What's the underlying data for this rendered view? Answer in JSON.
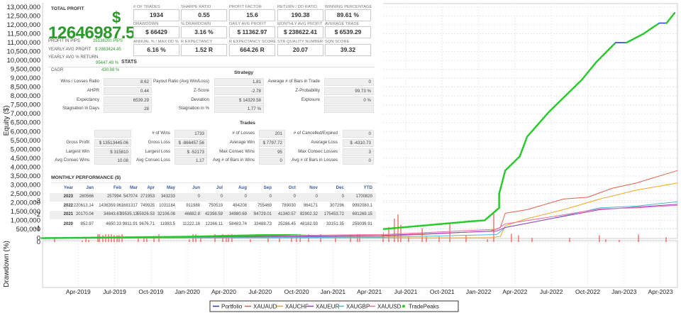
{
  "header": {
    "total_profit_label": "TOTAL PROFIT",
    "currency_symbol": "$",
    "total_profit_value": "12646987.5",
    "profit_in_pips_label": "PROFIT IN PIPS",
    "profit_in_pips_value": "25138200 PIPS",
    "yearly_avg_profit_label": "YEARLY AVG PROFIT",
    "yearly_avg_profit_value": "$ 2863424.45",
    "yearly_avg_return_label": "YEARLY AVG % RETURN",
    "yearly_avg_return_value": "95447.48 %",
    "stats_title": "STATS",
    "cagr_label": "CAGR",
    "cagr_value": "430.88 %"
  },
  "metrics": [
    {
      "label": "# OF TRADES",
      "value": "1934"
    },
    {
      "label": "SHARPE RATIO",
      "value": "0.55"
    },
    {
      "label": "PROFIT FACTOR",
      "value": "15.6"
    },
    {
      "label": "RETURN / DD RATIO",
      "value": "190.38"
    },
    {
      "label": "WINNING PERCENTAGE",
      "value": "89.61 %"
    },
    {
      "label": "DRAWDOWN",
      "value": "$ 66429"
    },
    {
      "label": "% DRAWDOWN",
      "value": "3.16 %"
    },
    {
      "label": "DAILY AVG PROFIT",
      "value": "$ 11362.97"
    },
    {
      "label": "MONTHLY AVG PROFIT",
      "value": "$ 238622.41"
    },
    {
      "label": "AVERAGE TRADE",
      "value": "$ 6539.29"
    },
    {
      "label": "ANNUAL % / MAX DD %",
      "value": "6.16 %"
    },
    {
      "label": "R EXPECTANCY",
      "value": "1.52 R"
    },
    {
      "label": "R EXPECTANCY SCORE",
      "value": "664.26 R"
    },
    {
      "label": "STR QUALITY NUMBER",
      "value": "20.07"
    },
    {
      "label": "SQN SCORE",
      "value": "39.32"
    }
  ],
  "strategy": {
    "title": "Strategy",
    "rows": [
      [
        {
          "label": "Wins / Losses Ratio",
          "value": "8.62"
        },
        {
          "label": "Payout Ratio (Avg Win/Loss)",
          "value": "1.81"
        },
        {
          "label": "Average # of Bars in Trade",
          "value": "0"
        }
      ],
      [
        {
          "label": "AHPR",
          "value": "0.44"
        },
        {
          "label": "Z-Score",
          "value": "-2.78"
        },
        {
          "label": "Z-Probability",
          "value": "99.73 %"
        }
      ],
      [
        {
          "label": "Expectancy",
          "value": "6539.29"
        },
        {
          "label": "Deviation",
          "value": "$ 14329.58"
        },
        {
          "label": "Exposure",
          "value": "0 %"
        }
      ],
      [
        {
          "label": "Stagnation in Days",
          "value": "28"
        },
        {
          "label": "Stagnation in %",
          "value": "1.77 %"
        },
        {
          "label": "",
          "value": ""
        }
      ]
    ]
  },
  "trades": {
    "title": "Trades",
    "rows": [
      [
        {
          "label": "",
          "value": ""
        },
        {
          "label": "# of Wins",
          "value": "1733"
        },
        {
          "label": "# of Losses",
          "value": "201"
        },
        {
          "label": "# of Cancelled/Expired",
          "value": "0"
        }
      ],
      [
        {
          "label": "Gross Profit",
          "value": "$ 13513445.06"
        },
        {
          "label": "Gross Loss",
          "value": "$ -866457.56"
        },
        {
          "label": "Average Win",
          "value": "$ 7797.72"
        },
        {
          "label": "Average Loss",
          "value": "$ -4310.73"
        }
      ],
      [
        {
          "label": "Largest Win",
          "value": "$ 315810"
        },
        {
          "label": "Largest Loss",
          "value": "$ -52173"
        },
        {
          "label": "Max Consec Wins",
          "value": "95"
        },
        {
          "label": "Max Consec Losses",
          "value": "3"
        }
      ],
      [
        {
          "label": "Avg Consec Wins",
          "value": "10.08"
        },
        {
          "label": "Avg Consec Loss",
          "value": "1.17"
        },
        {
          "label": "Avg # of Bars in Wins",
          "value": "0"
        },
        {
          "label": "Avg # of Bars in Losses",
          "value": "0"
        }
      ]
    ]
  },
  "monthly": {
    "title": "MONTHLY PERFORMANCE ($)",
    "headers": [
      "Year",
      "Jan",
      "Feb",
      "Mar",
      "Apr",
      "May",
      "Jun",
      "Jul",
      "Aug",
      "Sep",
      "Oct",
      "Nov",
      "Dec",
      "YTD"
    ],
    "rows": [
      [
        "2023",
        "280566",
        "257994",
        "547074",
        "271953",
        "343233",
        "0",
        "0",
        "0",
        "0",
        "0",
        "0",
        "0",
        "1700820"
      ],
      [
        "2022",
        "220613.14",
        "1436359.96",
        "1681317",
        "749925",
        "1031184",
        "911988",
        "750519",
        "494208",
        "755469",
        "789030",
        "864171",
        "307296",
        "9992080.1"
      ],
      [
        "2021",
        "20170.04",
        "34843.67",
        "39535.13",
        "55926.53",
        "32106.08",
        "46882.8",
        "42398.59",
        "34980.69",
        "84729.01",
        "41340.57",
        "82902.32",
        "175453.72",
        "691269.15"
      ],
      [
        "2020",
        "852.97",
        "4650.33",
        "9811.91",
        "9676.71",
        "11983.5",
        "11222.18",
        "12266.11",
        "58463.74",
        "33488.73",
        "25286.45",
        "48182.93",
        "33151.35",
        "259036.91"
      ]
    ]
  },
  "chart_data": {
    "type": "line",
    "x_units": "months since Jan-2019",
    "xlim": [
      0,
      52.5
    ],
    "x_ticks": [
      {
        "x": 3,
        "label": "Apr-2019"
      },
      {
        "x": 6,
        "label": "Jul-2019"
      },
      {
        "x": 9,
        "label": "Oct-2019"
      },
      {
        "x": 12,
        "label": "Jan-2020"
      },
      {
        "x": 15,
        "label": "Apr-2020"
      },
      {
        "x": 18,
        "label": "Jul-2020"
      },
      {
        "x": 21,
        "label": "Oct-2020"
      },
      {
        "x": 24,
        "label": "Jan-2021"
      },
      {
        "x": 27,
        "label": "Apr-2021"
      },
      {
        "x": 30,
        "label": "Jul-2021"
      },
      {
        "x": 33,
        "label": "Oct-2021"
      },
      {
        "x": 36,
        "label": "Jan-2022"
      },
      {
        "x": 39,
        "label": "Apr-2022"
      },
      {
        "x": 42,
        "label": "Jul-2022"
      },
      {
        "x": 45,
        "label": "Oct-2022"
      },
      {
        "x": 48,
        "label": "Jan-2023"
      },
      {
        "x": 51,
        "label": "Apr-2023"
      }
    ],
    "equity": {
      "ylabel": "Equity ($)",
      "ylim": [
        0,
        13300000
      ],
      "y_ticks": [
        0,
        500000,
        1000000,
        1500000,
        2000000,
        2500000,
        3000000,
        3500000,
        4000000,
        4500000,
        5000000,
        5500000,
        6000000,
        6500000,
        7000000,
        7500000,
        8000000,
        8500000,
        9000000,
        9500000,
        10000000,
        10500000,
        11000000,
        11500000,
        12000000,
        12500000,
        13000000
      ],
      "y_tick_labels": [
        "0",
        "500,000",
        "1,000,000",
        "1,500,000",
        "2,000,000",
        "2,500,000",
        "3,000,000",
        "3,500,000",
        "4,000,000",
        "4,500,000",
        "5,000,000",
        "5,500,000",
        "6,000,000",
        "6,500,000",
        "7,000,000",
        "7,500,000",
        "8,000,000",
        "8,500,000",
        "9,000,000",
        "9,500,000",
        "10,000,000",
        "10,500,000",
        "11,000,000",
        "11,500,000",
        "12,000,000",
        "12,500,000",
        "13,000,000"
      ],
      "series": [
        {
          "name": "XAUAUD",
          "color": "#e0604a",
          "points": [
            [
              0,
              0
            ],
            [
              28,
              100000
            ],
            [
              37,
              400000
            ],
            [
              37.8,
              600000
            ],
            [
              38.2,
              1400000
            ],
            [
              40,
              1600000
            ],
            [
              43,
              2200000
            ],
            [
              45,
              2300000
            ],
            [
              47,
              2800000
            ],
            [
              49,
              3100000
            ],
            [
              52.4,
              3800000
            ]
          ]
        },
        {
          "name": "XAUCHF",
          "color": "#f5a623",
          "points": [
            [
              0,
              0
            ],
            [
              37,
              20000
            ],
            [
              37.8,
              100000
            ],
            [
              38.2,
              700000
            ],
            [
              40,
              1100000
            ],
            [
              43,
              1600000
            ],
            [
              46,
              2200000
            ],
            [
              49,
              2700000
            ],
            [
              52.4,
              3100000
            ]
          ]
        },
        {
          "name": "XAUGBP",
          "color": "#4fb8d8",
          "points": [
            [
              0,
              0
            ],
            [
              28,
              50000
            ],
            [
              37.5,
              200000
            ],
            [
              38.2,
              600000
            ],
            [
              42,
              1100000
            ],
            [
              46,
              1700000
            ],
            [
              49,
              1800000
            ],
            [
              52.4,
              2050000
            ]
          ]
        },
        {
          "name": "XAUEUR",
          "color": "#a040c0",
          "points": [
            [
              0,
              0
            ],
            [
              28,
              150000
            ],
            [
              37.5,
              400000
            ],
            [
              38.2,
              600000
            ],
            [
              42,
              1100000
            ],
            [
              46,
              1600000
            ],
            [
              49,
              1750000
            ],
            [
              52.4,
              1900000
            ]
          ]
        },
        {
          "name": "XAUUSD",
          "color": "#f06aa0",
          "points": [
            [
              0,
              0
            ],
            [
              28,
              200000
            ],
            [
              37.5,
              500000
            ],
            [
              38.2,
              800000
            ],
            [
              42,
              1200000
            ],
            [
              46,
              1650000
            ],
            [
              49,
              1700000
            ],
            [
              52.4,
              1850000
            ]
          ]
        },
        {
          "name": "Portfolio",
          "color": "#2a3fd8",
          "points": [
            [
              0,
              0
            ],
            [
              12,
              80000
            ],
            [
              20,
              200000
            ],
            [
              28,
              500000
            ],
            [
              35.3,
              940000
            ],
            [
              36.5,
              1000000
            ],
            [
              37.7,
              1700000
            ],
            [
              37.7,
              2500000
            ],
            [
              38.2,
              3800000
            ],
            [
              39.4,
              4600000
            ],
            [
              40,
              5700000
            ],
            [
              41.8,
              7100000
            ],
            [
              43.3,
              8100000
            ],
            [
              44.5,
              8900000
            ],
            [
              45.7,
              9900000
            ],
            [
              47.3,
              11000000
            ],
            [
              48.2,
              11000000
            ],
            [
              49.6,
              11500000
            ],
            [
              50.9,
              12100000
            ],
            [
              51.5,
              12100000
            ],
            [
              52.2,
              12700000
            ]
          ]
        }
      ],
      "peaks": {
        "name": "TradePeaks",
        "color": "#22cc22",
        "follows": "Portfolio"
      }
    },
    "drawdown": {
      "type": "bar",
      "ylabel": "Drawdown (%)",
      "ylim": [
        -3.3,
        0
      ],
      "y_ticks": [
        0,
        -1,
        -2,
        -3
      ],
      "color": "#ee3333",
      "bars": [
        [
          1.05,
          -0.35
        ],
        [
          3.33,
          -0.1
        ],
        [
          3.63,
          -0.25
        ],
        [
          3.86,
          -0.15
        ],
        [
          4.62,
          -1.35
        ],
        [
          4.74,
          -0.8
        ],
        [
          5.03,
          -0.5
        ],
        [
          5.26,
          -1.3
        ],
        [
          5.5,
          -0.65
        ],
        [
          5.73,
          -1.75
        ],
        [
          5.96,
          -0.5
        ],
        [
          6.2,
          -0.5
        ],
        [
          6.37,
          -0.5
        ],
        [
          6.61,
          -1.45
        ],
        [
          7.95,
          -0.25
        ],
        [
          8.42,
          -0.25
        ],
        [
          8.65,
          -0.4
        ],
        [
          9.24,
          -0.4
        ],
        [
          9.65,
          -1.05
        ],
        [
          12.16,
          -0.2
        ],
        [
          12.46,
          -0.6
        ],
        [
          12.69,
          -1.05
        ],
        [
          13.1,
          -0.3
        ],
        [
          14.27,
          -1.0
        ],
        [
          14.91,
          -1.3
        ],
        [
          15.2,
          -0.5
        ],
        [
          15.38,
          -0.55
        ],
        [
          15.67,
          -0.95
        ],
        [
          17.19,
          -0.2
        ],
        [
          18.65,
          -0.85
        ],
        [
          19.59,
          -0.3
        ],
        [
          20.58,
          -0.45
        ],
        [
          20.99,
          -2.1
        ],
        [
          21.29,
          -0.9
        ],
        [
          21.99,
          -0.8
        ],
        [
          22.98,
          -0.95
        ],
        [
          24.21,
          -0.45
        ],
        [
          25.44,
          -0.55
        ],
        [
          26.02,
          -3.15
        ],
        [
          26.2,
          -1.3
        ],
        [
          28.13,
          -0.7
        ],
        [
          28.6,
          -1.1
        ],
        [
          29.06,
          -1.7
        ],
        [
          29.36,
          -2.0
        ],
        [
          29.59,
          -1.25
        ],
        [
          30.23,
          -0.4
        ],
        [
          31.35,
          -1.0
        ],
        [
          31.7,
          -0.4
        ],
        [
          32.75,
          -0.4
        ],
        [
          33.63,
          -1.4
        ],
        [
          34.97,
          -0.5
        ],
        [
          36.73,
          -0.2
        ],
        [
          37.25,
          -2.2
        ],
        [
          38.71,
          -0.6
        ],
        [
          39.3,
          -0.5
        ],
        [
          40.41,
          -0.3
        ],
        [
          43.51,
          -0.3
        ],
        [
          45.96,
          -0.5
        ],
        [
          46.49,
          -0.2
        ],
        [
          47.6,
          -0.15
        ],
        [
          49.18,
          -0.55
        ],
        [
          51.46,
          -0.35
        ]
      ]
    },
    "legend": {
      "position": "bottom-center",
      "entries": [
        "Portfolio",
        "XAUAUD",
        "XAUCHF",
        "XAUEUR",
        "XAUGBP",
        "XAUUSD",
        "TradePeaks"
      ]
    }
  }
}
